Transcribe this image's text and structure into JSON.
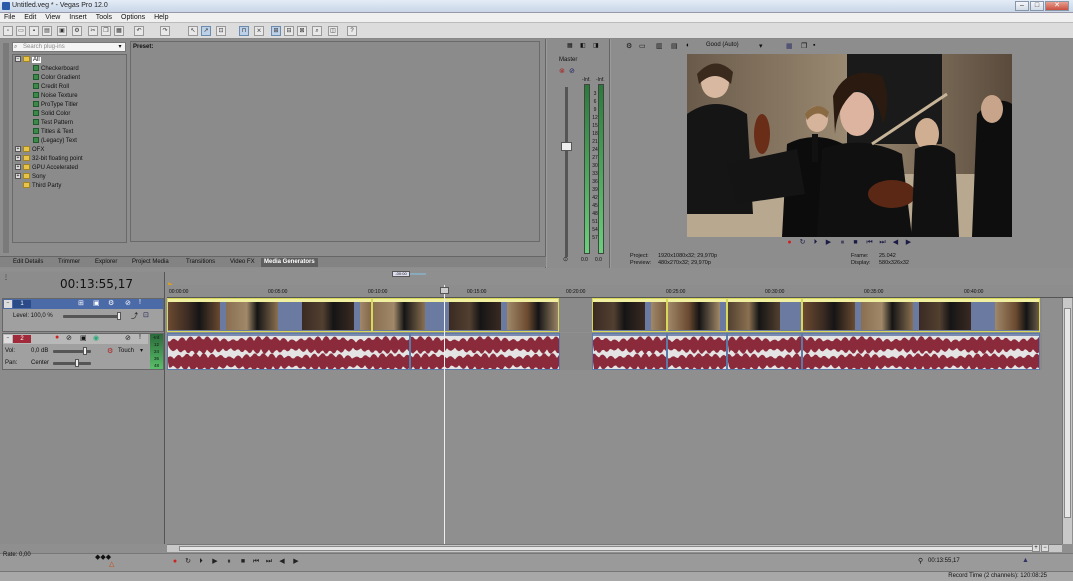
{
  "window": {
    "title": "Untitled.veg * - Vegas Pro 12.0",
    "minimize": "–",
    "maximize": "□",
    "close": "✕"
  },
  "menu": [
    "File",
    "Edit",
    "View",
    "Insert",
    "Tools",
    "Options",
    "Help"
  ],
  "explorer": {
    "search_placeholder": "Search plug-ins",
    "preset_label": "Preset:",
    "tree": [
      {
        "label": "All",
        "level": 0,
        "type": "folder",
        "selected": true
      },
      {
        "label": "Checkerboard",
        "level": 1,
        "type": "gen"
      },
      {
        "label": "Color Gradient",
        "level": 1,
        "type": "gen"
      },
      {
        "label": "Credit Roll",
        "level": 1,
        "type": "gen"
      },
      {
        "label": "Noise Texture",
        "level": 1,
        "type": "gen"
      },
      {
        "label": "ProType Titler",
        "level": 1,
        "type": "gen"
      },
      {
        "label": "Solid Color",
        "level": 1,
        "type": "gen"
      },
      {
        "label": "Test Pattern",
        "level": 1,
        "type": "gen"
      },
      {
        "label": "Titles & Text",
        "level": 1,
        "type": "gen"
      },
      {
        "label": "(Legacy) Text",
        "level": 1,
        "type": "gen"
      },
      {
        "label": "OFX",
        "level": 0,
        "type": "folder"
      },
      {
        "label": "32-bit floating point",
        "level": 0,
        "type": "folder"
      },
      {
        "label": "GPU Accelerated",
        "level": 0,
        "type": "folder"
      },
      {
        "label": "Sony",
        "level": 0,
        "type": "folder"
      },
      {
        "label": "Third Party",
        "level": 0,
        "type": "folder"
      }
    ],
    "tabs": [
      "Edit Details",
      "Trimmer",
      "Explorer",
      "Project Media",
      "Transitions",
      "Video FX",
      "Media Generators"
    ],
    "active_tab": "Media Generators"
  },
  "mixer": {
    "title": "Master",
    "inf_left": "-Inf.",
    "inf_right": "-Inf.",
    "scale": [
      "3",
      "6",
      "9",
      "12",
      "15",
      "18",
      "21",
      "24",
      "27",
      "30",
      "33",
      "36",
      "39",
      "42",
      "45",
      "48",
      "51",
      "54",
      "57"
    ],
    "val_left": "0.0",
    "val_right": "0.0"
  },
  "preview": {
    "quality": "Good (Auto)",
    "project_label": "Project:",
    "project_value": "1920x1080x32; 29,970p",
    "preview_label": "Preview:",
    "preview_value": "480x270x32; 29,970p",
    "frame_label": "Frame:",
    "frame_value": "25.042",
    "display_label": "Display:",
    "display_value": "580x326x32"
  },
  "timeline": {
    "timecode": "00:13:55,17",
    "ruler": [
      "00:00:00",
      "00:05:00",
      "00:10:00",
      "00:15:00",
      "00:20:00",
      "00:25:00",
      "00:30:00",
      "00:35:00",
      "00:40:00"
    ],
    "loop_label": "-00:00",
    "video_track": {
      "number": "1",
      "level": "Level: 100,0 %"
    },
    "audio_track": {
      "number": "2",
      "vol_label": "Vol:",
      "vol_value": "0,0 dB",
      "pan_label": "Pan:",
      "pan_value": "Center",
      "mode": "Touch",
      "meter": [
        "-Inf.",
        "12",
        "24",
        "36",
        "48"
      ]
    },
    "rate": "Rate: 0,00",
    "cursor_time": "00:13:55,17",
    "record_time": "Record Time (2 channels): 120:08:25"
  },
  "colors": {
    "audio_wave": "#8b2a3a",
    "clip_border": "#d8d85a",
    "accent": "#2a5aa8"
  }
}
